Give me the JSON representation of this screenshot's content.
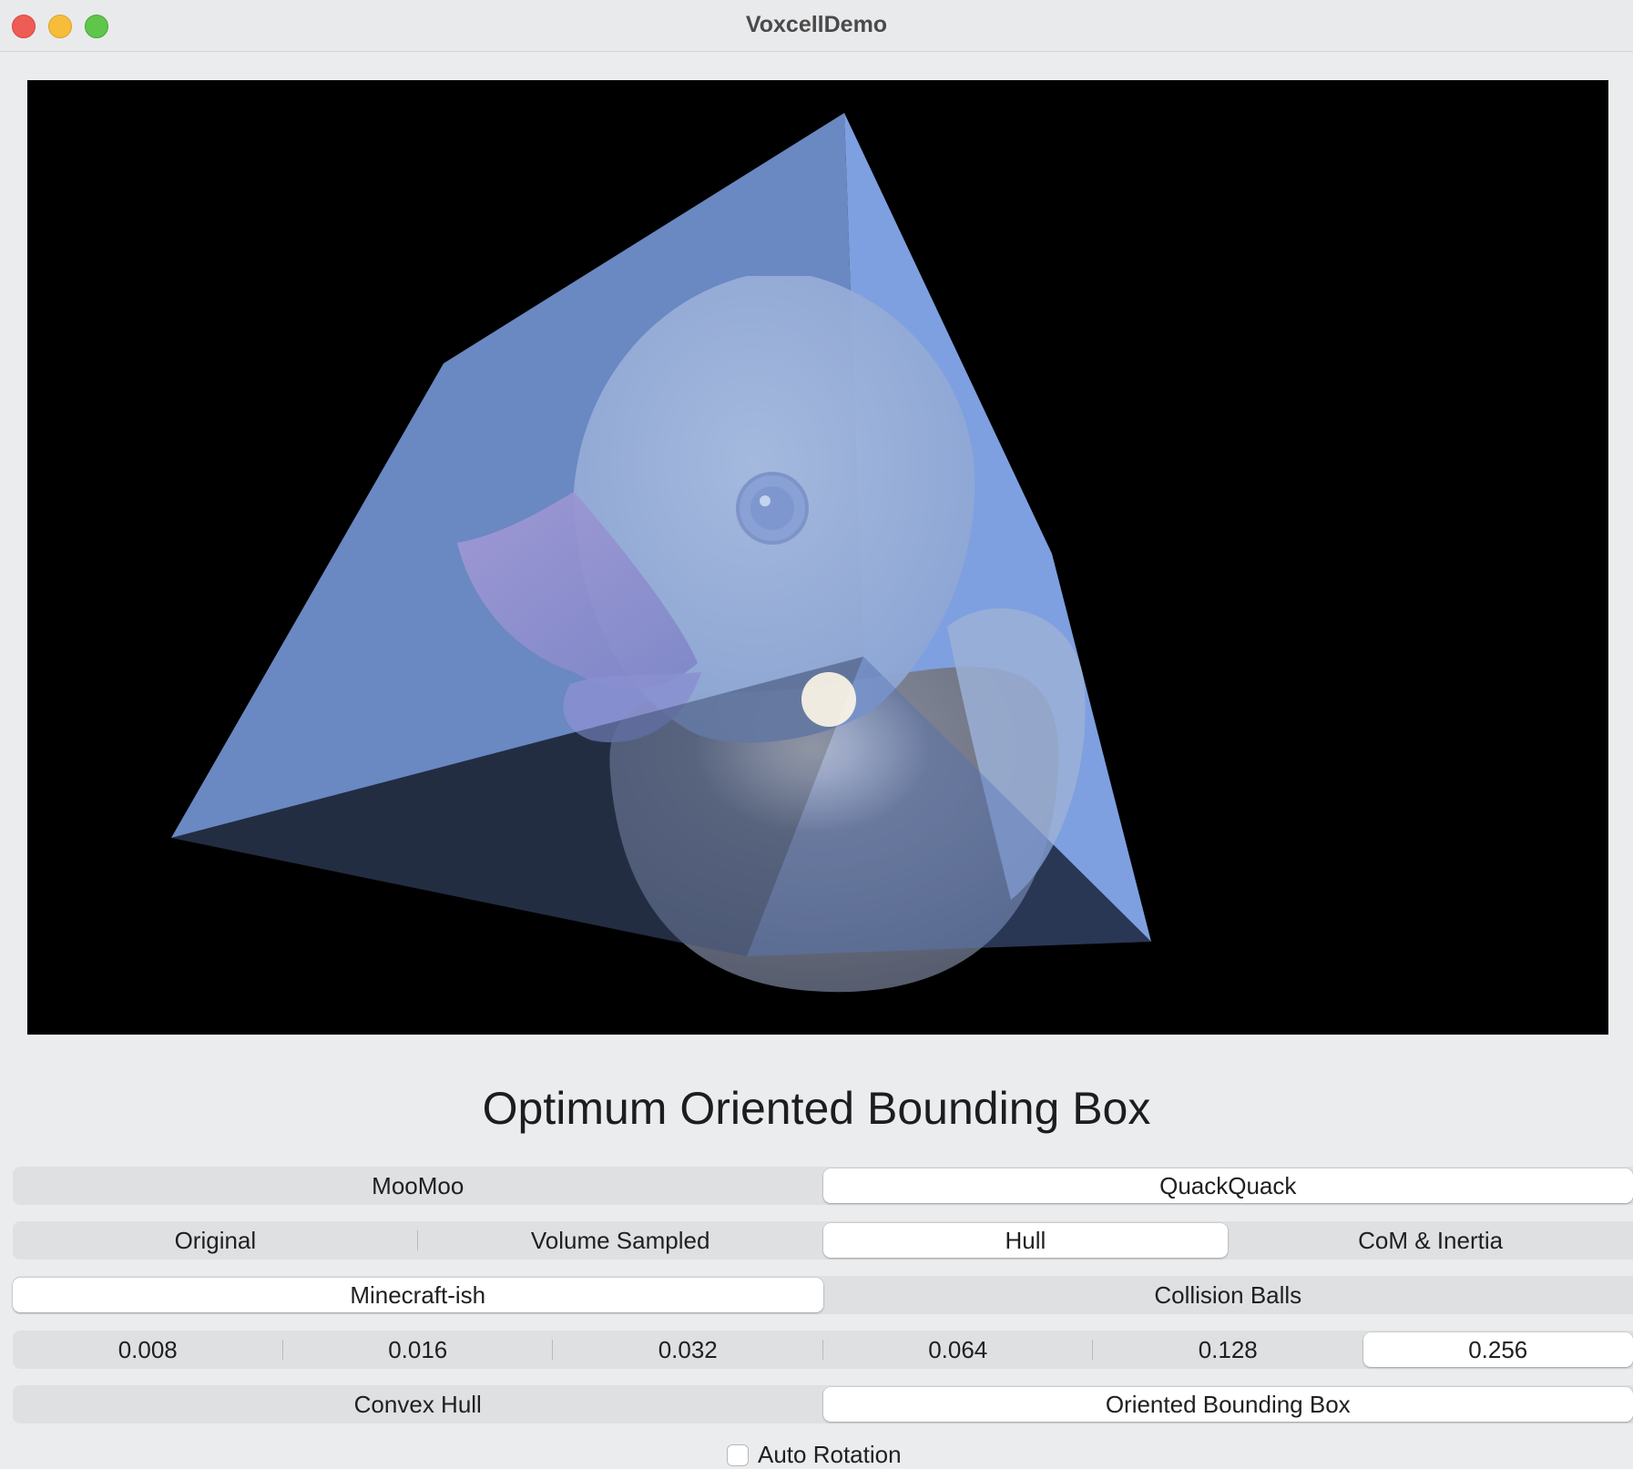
{
  "window": {
    "title": "VoxcellDemo",
    "controls": [
      "close",
      "minimize",
      "zoom"
    ]
  },
  "viewport": {
    "background": "#000000",
    "scene": {
      "object": "rubber duck",
      "overlay": "oriented bounding box",
      "box_color": "#6f92d8"
    }
  },
  "page_title": "Optimum Oriented Bounding Box",
  "model_selector": {
    "options": [
      "MooMoo",
      "QuackQuack"
    ],
    "selected": "QuackQuack"
  },
  "mode_selector": {
    "options": [
      "Original",
      "Volume Sampled",
      "Hull",
      "CoM & Inertia"
    ],
    "selected": "Hull"
  },
  "render_style_selector": {
    "options": [
      "Minecraft-ish",
      "Collision Balls"
    ],
    "selected": "Minecraft-ish"
  },
  "voxel_size_selector": {
    "options": [
      "0.008",
      "0.016",
      "0.032",
      "0.064",
      "0.128",
      "0.256"
    ],
    "selected": "0.256"
  },
  "hull_type_selector": {
    "options": [
      "Convex Hull",
      "Oriented Bounding Box"
    ],
    "selected": "Oriented Bounding Box"
  },
  "auto_rotation": {
    "label": "Auto Rotation",
    "checked": false
  }
}
